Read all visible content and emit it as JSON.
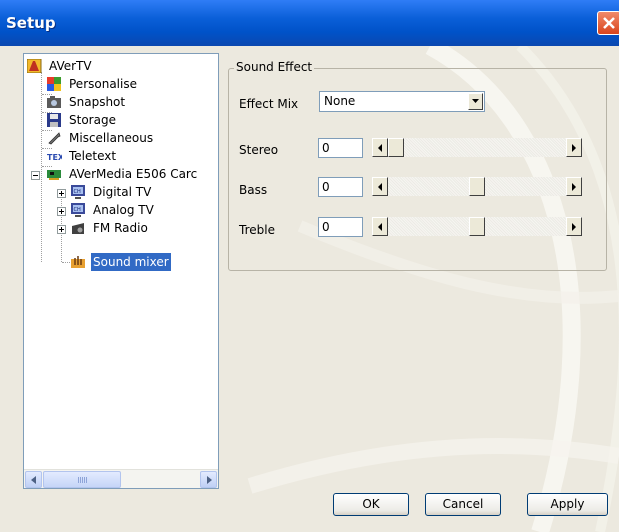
{
  "window": {
    "title": "Setup"
  },
  "tree": {
    "items": [
      {
        "label": "AVerTV",
        "icon": "avertv-icon",
        "level": 0
      },
      {
        "label": "Personalise",
        "icon": "personalise-icon",
        "level": 1
      },
      {
        "label": "Snapshot",
        "icon": "camera-icon",
        "level": 1
      },
      {
        "label": "Storage",
        "icon": "floppy-disk-icon",
        "level": 1
      },
      {
        "label": "Miscellaneous",
        "icon": "wrench-icon",
        "level": 1
      },
      {
        "label": "Teletext",
        "icon": "teletext-icon",
        "level": 1
      },
      {
        "label": "AVerMedia E506 Carc",
        "icon": "tv-card-icon",
        "level": 1
      },
      {
        "label": "Digital TV",
        "icon": "digital-tv-icon",
        "level": 2
      },
      {
        "label": "Analog TV",
        "icon": "analog-tv-icon",
        "level": 2
      },
      {
        "label": "FM Radio",
        "icon": "radio-icon",
        "level": 2
      },
      {
        "label": "Sound mixer",
        "icon": "sound-mixer-icon",
        "level": 2,
        "selected": true
      }
    ]
  },
  "sound_effect": {
    "group_label": "Sound Effect",
    "effect_mix": {
      "label": "Effect Mix",
      "value": "None"
    },
    "stereo": {
      "label": "Stereo",
      "value": "0",
      "slider_position": 0.0
    },
    "bass": {
      "label": "Bass",
      "value": "0",
      "slider_position": 0.5
    },
    "treble": {
      "label": "Treble",
      "value": "0",
      "slider_position": 0.5
    }
  },
  "buttons": {
    "ok": "OK",
    "cancel": "Cancel",
    "apply": "Apply"
  },
  "colors": {
    "titlebar": "#0052c8",
    "selection": "#316ac5",
    "close": "#d9441c"
  }
}
